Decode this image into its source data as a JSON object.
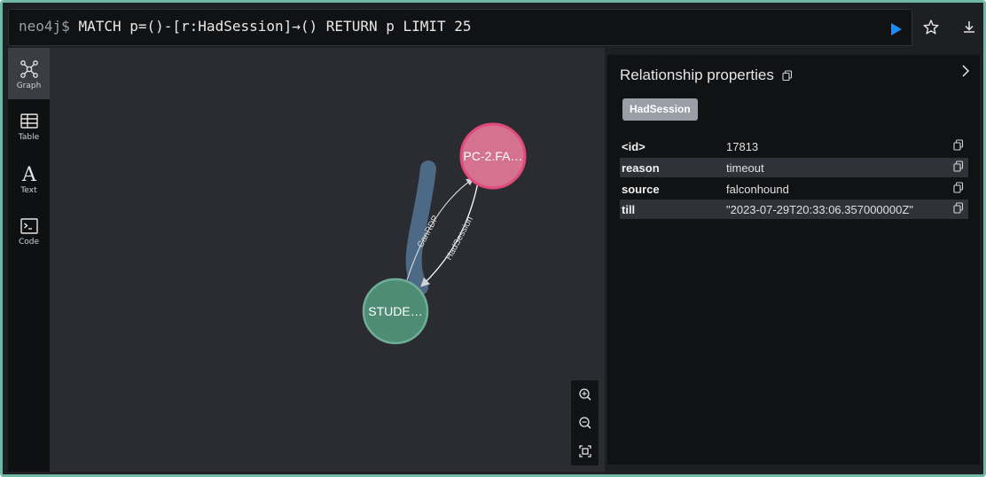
{
  "query": {
    "prompt": "neo4j$",
    "text": "MATCH p=()-[r:HadSession]→() RETURN p LIMIT 25",
    "run_icon": "play-icon",
    "favorite_icon": "star-icon",
    "download_icon": "download-icon"
  },
  "nav": [
    {
      "label": "Graph",
      "icon": "graph-icon",
      "active": true
    },
    {
      "label": "Table",
      "icon": "table-icon",
      "active": false
    },
    {
      "label": "Text",
      "icon": "text-icon",
      "active": false
    },
    {
      "label": "Code",
      "icon": "code-icon",
      "active": false
    }
  ],
  "graph": {
    "nodes": [
      {
        "label": "PC-2.FA…",
        "color": "#d5728f",
        "border": "#e04a7a"
      },
      {
        "label": "STUDE…",
        "color": "#4f8c76",
        "border": "#6fae96"
      }
    ],
    "relationships": [
      {
        "type": "CanRDP",
        "selected": false
      },
      {
        "type": "HadSession",
        "selected": true
      }
    ]
  },
  "zoom": {
    "zoom_in_icon": "zoom-in-icon",
    "zoom_out_icon": "zoom-out-icon",
    "fit_icon": "fit-screen-icon"
  },
  "properties": {
    "title": "Relationship properties",
    "type_chip": "HadSession",
    "rows": [
      {
        "key": "<id>",
        "value": "17813"
      },
      {
        "key": "reason",
        "value": "timeout"
      },
      {
        "key": "source",
        "value": "falconhound"
      },
      {
        "key": "till",
        "value": "\"2023-07-29T20:33:06.357000000Z\""
      }
    ]
  },
  "colors": {
    "frame_border": "#6fb9a8",
    "run_button": "#1a8cff",
    "selected_rel": "#4c6a86"
  }
}
